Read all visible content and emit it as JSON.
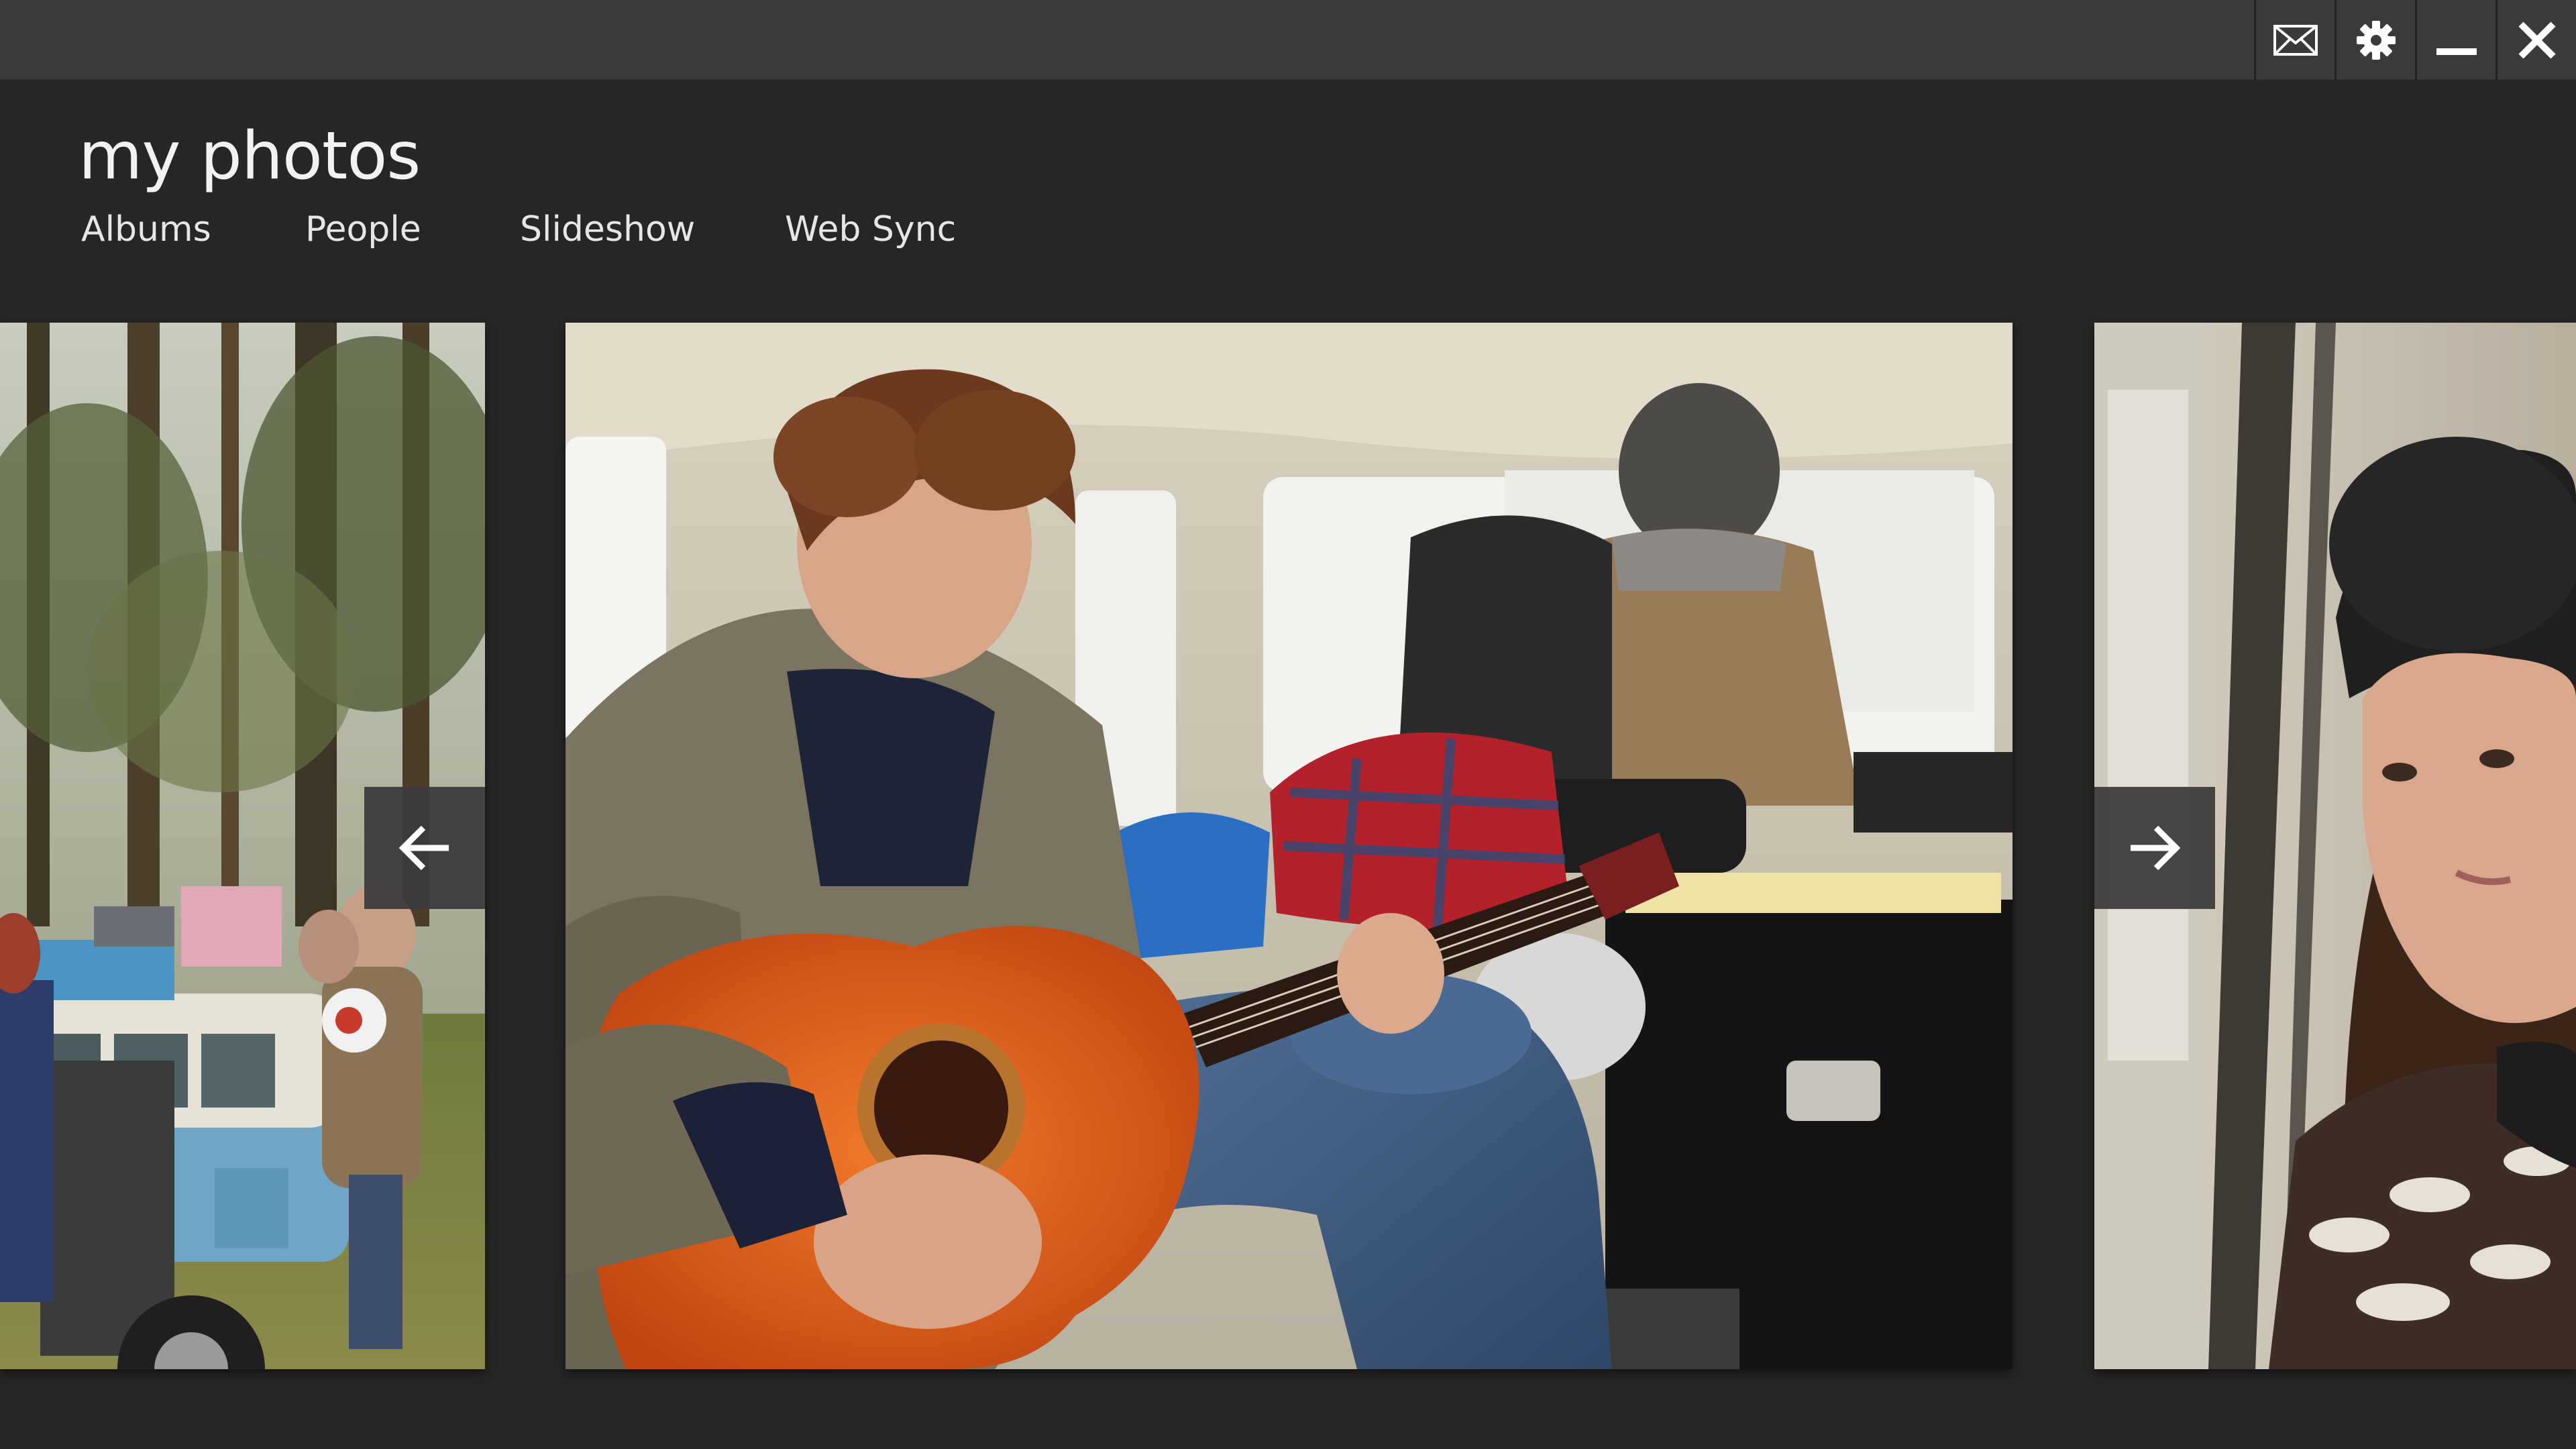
{
  "titlebar": {
    "buttons": [
      {
        "id": "mail",
        "icon": "mail-icon"
      },
      {
        "id": "settings",
        "icon": "gear-icon"
      },
      {
        "id": "minimize",
        "icon": "minimize-icon"
      },
      {
        "id": "close",
        "icon": "close-icon"
      }
    ]
  },
  "app": {
    "title": "my photos"
  },
  "nav": {
    "items": [
      {
        "label": "Albums"
      },
      {
        "label": "People"
      },
      {
        "label": "Slideshow"
      },
      {
        "label": "Web Sync"
      }
    ]
  },
  "gallery": {
    "prev_icon": "arrow-left-icon",
    "next_icon": "arrow-right-icon",
    "photos": [
      {
        "position": "previous",
        "subject": "friends loading a camper van in a forest"
      },
      {
        "position": "current",
        "subject": "young man playing guitar in the back of a car"
      },
      {
        "position": "next",
        "subject": "woman in knit hat looking out a car window"
      }
    ]
  },
  "colors": {
    "background": "#262627",
    "titlebar": "#3a3a3b",
    "text": "#f2f2f2",
    "arrow_bg": "#3a3a3a"
  }
}
